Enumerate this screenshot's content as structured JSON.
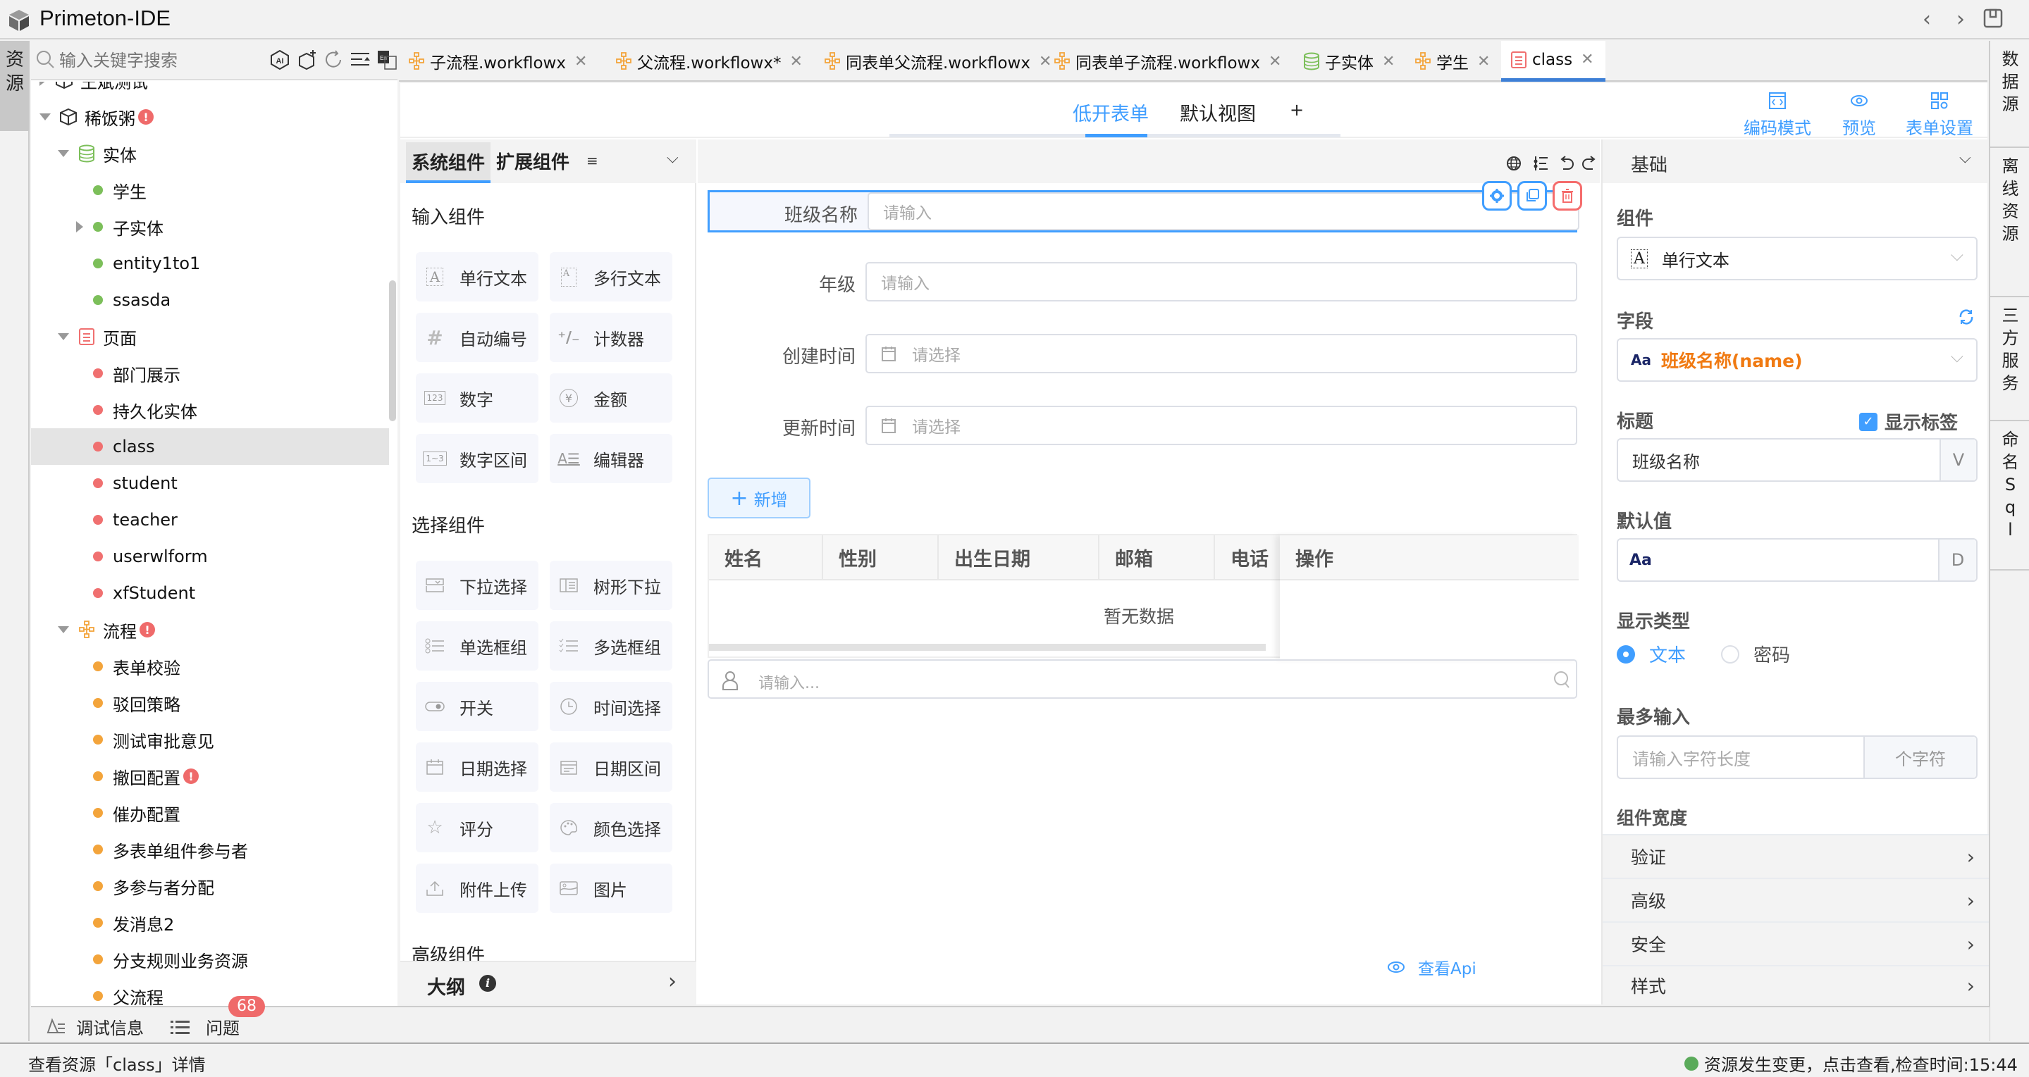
{
  "app": {
    "title": "Primeton-IDE"
  },
  "left_strip": {
    "tab_label": "资\n源"
  },
  "explorer": {
    "search_placeholder": "输入关键字搜索",
    "toolbar_icons": [
      "ai-icon",
      "add-module-icon",
      "refresh-icon",
      "collapse-all-icon",
      "language-icon"
    ],
    "tree": [
      {
        "label": "王斌测试",
        "level": 0,
        "caret": "right",
        "icon": "package-icon"
      },
      {
        "label": "稀饭粥",
        "level": 0,
        "caret": "down",
        "icon": "package-icon",
        "warning": true
      },
      {
        "label": "实体",
        "level": 1,
        "caret": "down",
        "icon": "database-icon"
      },
      {
        "label": "学生",
        "level": 2,
        "dot": "#7cbf5a"
      },
      {
        "label": "子实体",
        "level": 2,
        "dot": "#7cbf5a",
        "caret": "right"
      },
      {
        "label": "entity1to1",
        "level": 2,
        "dot": "#7cbf5a"
      },
      {
        "label": "ssasda",
        "level": 2,
        "dot": "#7cbf5a"
      },
      {
        "label": "页面",
        "level": 1,
        "caret": "down",
        "icon": "page-icon"
      },
      {
        "label": "部门展示",
        "level": 2,
        "dot": "#f07070"
      },
      {
        "label": "持久化实体",
        "level": 2,
        "dot": "#f07070"
      },
      {
        "label": "class",
        "level": 2,
        "dot": "#f07070",
        "selected": true
      },
      {
        "label": "student",
        "level": 2,
        "dot": "#f07070"
      },
      {
        "label": "teacher",
        "level": 2,
        "dot": "#f07070"
      },
      {
        "label": "userwlform",
        "level": 2,
        "dot": "#f07070"
      },
      {
        "label": "xfStudent",
        "level": 2,
        "dot": "#f07070"
      },
      {
        "label": "流程",
        "level": 1,
        "caret": "down",
        "icon": "workflow-icon",
        "warning": true
      },
      {
        "label": "表单校验",
        "level": 2,
        "dot": "#f3a43b"
      },
      {
        "label": "驳回策略",
        "level": 2,
        "dot": "#f3a43b"
      },
      {
        "label": "测试审批意见",
        "level": 2,
        "dot": "#f3a43b"
      },
      {
        "label": "撤回配置",
        "level": 2,
        "dot": "#f3a43b",
        "warning": true
      },
      {
        "label": "催办配置",
        "level": 2,
        "dot": "#f3a43b"
      },
      {
        "label": "多表单组件参与者",
        "level": 2,
        "dot": "#f3a43b"
      },
      {
        "label": "多参与者分配",
        "level": 2,
        "dot": "#f3a43b"
      },
      {
        "label": "发消息2",
        "level": 2,
        "dot": "#f3a43b"
      },
      {
        "label": "分支规则业务资源",
        "level": 2,
        "dot": "#f3a43b"
      },
      {
        "label": "父流程",
        "level": 2,
        "dot": "#f3a43b"
      }
    ]
  },
  "bottom_tabs": {
    "debug_label": "调试信息",
    "problems_label": "问题",
    "problems_count": "68"
  },
  "status_bar": {
    "left_text": "查看资源「class」详情",
    "right_text": "资源发生变更，点击查看,检查时间:15:44",
    "status_color": "#5aaa5a"
  },
  "editor_tabs": [
    {
      "label": "子流程.workflowx",
      "icon": "workflow-icon",
      "color": "#f3a43b"
    },
    {
      "label": "父流程.workflowx*",
      "icon": "workflow-icon",
      "color": "#f3a43b"
    },
    {
      "label": "同表单父流程.workflowx",
      "icon": "workflow-icon",
      "color": "#f3a43b"
    },
    {
      "label": "同表单子流程.workflowx",
      "icon": "workflow-icon",
      "color": "#f3a43b"
    },
    {
      "label": "子实体",
      "icon": "database-icon",
      "color": "#7cbf5a"
    },
    {
      "label": "学生",
      "icon": "workflow-icon",
      "color": "#f3a43b"
    },
    {
      "label": "class",
      "icon": "page-icon",
      "color": "#f07070",
      "active": true
    }
  ],
  "view_tabs": {
    "tabs": [
      "低开表单",
      "默认视图"
    ],
    "add_label": "+",
    "active_index": 0
  },
  "view_tools": {
    "code_mode": "编码模式",
    "preview": "预览",
    "form_settings": "表单设置"
  },
  "palette": {
    "tab_system": "系统组件",
    "tab_extension": "扩展组件",
    "sections": [
      {
        "title": "输入组件",
        "items": [
          {
            "label": "单行文本",
            "icon": "single-line-text-icon"
          },
          {
            "label": "多行文本",
            "icon": "multi-line-text-icon"
          },
          {
            "label": "自动编号",
            "icon": "hash-icon"
          },
          {
            "label": "计数器",
            "icon": "counter-icon"
          },
          {
            "label": "数字",
            "icon": "number-icon"
          },
          {
            "label": "金额",
            "icon": "yuan-icon"
          },
          {
            "label": "数字区间",
            "icon": "number-range-icon"
          },
          {
            "label": "编辑器",
            "icon": "editor-icon"
          }
        ]
      },
      {
        "title": "选择组件",
        "items": [
          {
            "label": "下拉选择",
            "icon": "dropdown-icon"
          },
          {
            "label": "树形下拉",
            "icon": "tree-select-icon"
          },
          {
            "label": "单选框组",
            "icon": "radio-group-icon"
          },
          {
            "label": "多选框组",
            "icon": "checkbox-group-icon"
          },
          {
            "label": "开关",
            "icon": "switch-icon"
          },
          {
            "label": "时间选择",
            "icon": "clock-icon"
          },
          {
            "label": "日期选择",
            "icon": "calendar-icon"
          },
          {
            "label": "日期区间",
            "icon": "date-range-icon"
          },
          {
            "label": "评分",
            "icon": "star-icon"
          },
          {
            "label": "颜色选择",
            "icon": "palette-icon"
          },
          {
            "label": "附件上传",
            "icon": "upload-icon"
          },
          {
            "label": "图片",
            "icon": "image-icon"
          }
        ]
      },
      {
        "title": "高级组件",
        "items": []
      }
    ],
    "outline_label": "大纲"
  },
  "canvas": {
    "fields": [
      {
        "label": "班级名称",
        "placeholder": "请输入",
        "type": "text",
        "selected": true
      },
      {
        "label": "年级",
        "placeholder": "请输入",
        "type": "text"
      },
      {
        "label": "创建时间",
        "placeholder": "请选择",
        "type": "date"
      },
      {
        "label": "更新时间",
        "placeholder": "请选择",
        "type": "date"
      }
    ],
    "add_button": "新增",
    "subtable": {
      "columns": [
        "姓名",
        "性别",
        "出生日期",
        "邮箱",
        "电话"
      ],
      "fixed_column": "操作",
      "empty_text": "暂无数据"
    },
    "subtable_search_placeholder": "请输入...",
    "view_api": "查看Api"
  },
  "properties": {
    "section": "基础",
    "component_label": "组件",
    "component_value": "单行文本",
    "field_label": "字段",
    "field_value": "班级名称(name)",
    "title_label": "标题",
    "show_label_text": "显示标签",
    "show_label_checked": true,
    "title_value": "班级名称",
    "title_suffix": "V",
    "default_label": "默认值",
    "default_prefix": "Aa",
    "default_suffix": "D",
    "display_type_label": "显示类型",
    "display_types": [
      "文本",
      "密码"
    ],
    "display_type_selected": 0,
    "max_input_label": "最多输入",
    "max_input_placeholder": "请输入字符长度",
    "max_input_suffix": "个字符",
    "width_label": "组件宽度",
    "groups": [
      "验证",
      "高级",
      "安全",
      "样式"
    ]
  },
  "right_strip": {
    "tabs": [
      "数据源",
      "离线资源",
      "三方服务",
      "命名Sql"
    ]
  },
  "colors": {
    "accent": "#409eff",
    "danger": "#f56c6c",
    "field_highlight": "#f07a12"
  }
}
